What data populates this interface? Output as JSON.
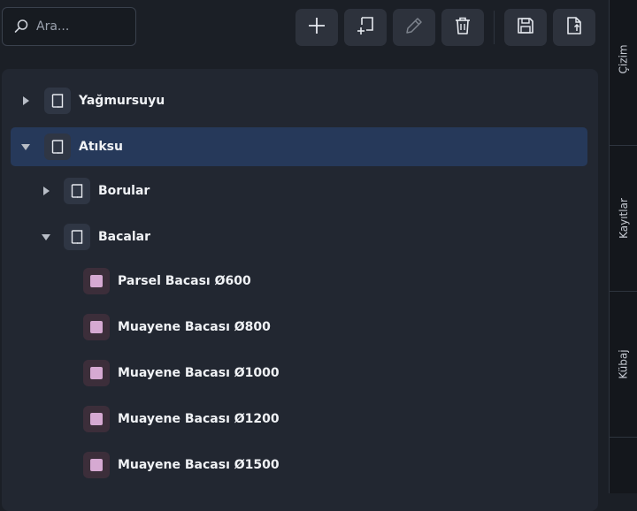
{
  "search": {
    "placeholder": "Ara...",
    "value": ""
  },
  "toolbar": {
    "buttons": [
      {
        "name": "add",
        "icon": "plus-icon"
      },
      {
        "name": "add-child",
        "icon": "add-sheet-icon"
      },
      {
        "name": "edit",
        "icon": "pencil-icon"
      },
      {
        "name": "delete",
        "icon": "trash-icon"
      },
      {
        "name": "save",
        "icon": "floppy-icon"
      },
      {
        "name": "export",
        "icon": "file-export-icon"
      }
    ]
  },
  "tree": {
    "selected": "Atıksu",
    "nodes": [
      {
        "label": "Yağmursuyu",
        "level": 0,
        "expanded": false
      },
      {
        "label": "Atıksu",
        "level": 0,
        "expanded": true
      },
      {
        "label": "Borular",
        "level": 1,
        "expanded": false
      },
      {
        "label": "Bacalar",
        "level": 1,
        "expanded": true
      },
      {
        "label": "Parsel Bacası Ø600",
        "level": 2,
        "color": "#d6a9d2"
      },
      {
        "label": "Muayene Bacası Ø800",
        "level": 2,
        "color": "#d6a9d2"
      },
      {
        "label": "Muayene Bacası Ø1000",
        "level": 2,
        "color": "#d6a9d2"
      },
      {
        "label": "Muayene Bacası Ø1200",
        "level": 2,
        "color": "#d6a9d2"
      },
      {
        "label": "Muayene Bacası Ø1500",
        "level": 2,
        "color": "#d6a9d2"
      }
    ]
  },
  "side_tabs": [
    "Çizim",
    "Kayıtlar",
    "Kübaj"
  ],
  "colors": {
    "background": "#1b1f26",
    "panel": "#222731",
    "selection": "#26395a",
    "item_swatch": "#d6a9d2"
  }
}
